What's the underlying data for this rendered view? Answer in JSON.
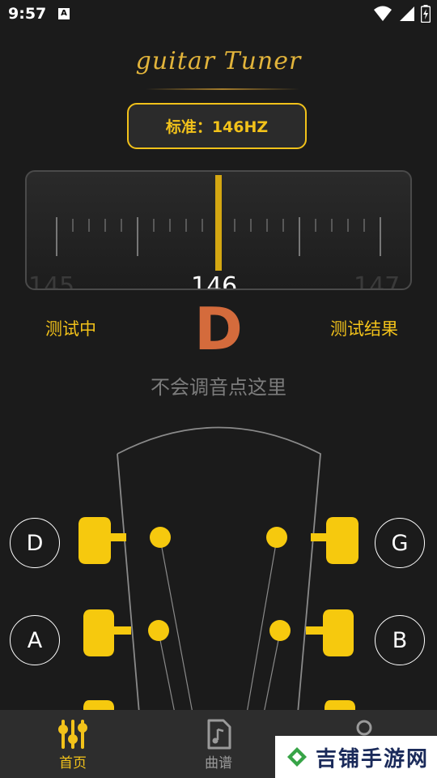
{
  "status": {
    "time": "9:57",
    "notif": "A"
  },
  "logo": {
    "text": "guitar Tuner"
  },
  "standard": {
    "label": "标准：146HZ"
  },
  "meter": {
    "value": "146",
    "left": "145",
    "right": "147"
  },
  "actions": {
    "testing": "测试中",
    "result": "测试结果"
  },
  "note": "D",
  "help": "不会调音点这里",
  "strings": {
    "left_top": "D",
    "left_mid": "A",
    "right_top": "G",
    "right_mid": "B"
  },
  "tabs": [
    {
      "label": "首页",
      "active": true
    },
    {
      "label": "曲谱",
      "active": false
    },
    {
      "label": "",
      "active": false
    }
  ],
  "colors": {
    "accent": "#f2c21a",
    "note": "#d46b3c",
    "background": "#1b1b1b"
  },
  "watermark": {
    "text": "吉铺手游网"
  }
}
